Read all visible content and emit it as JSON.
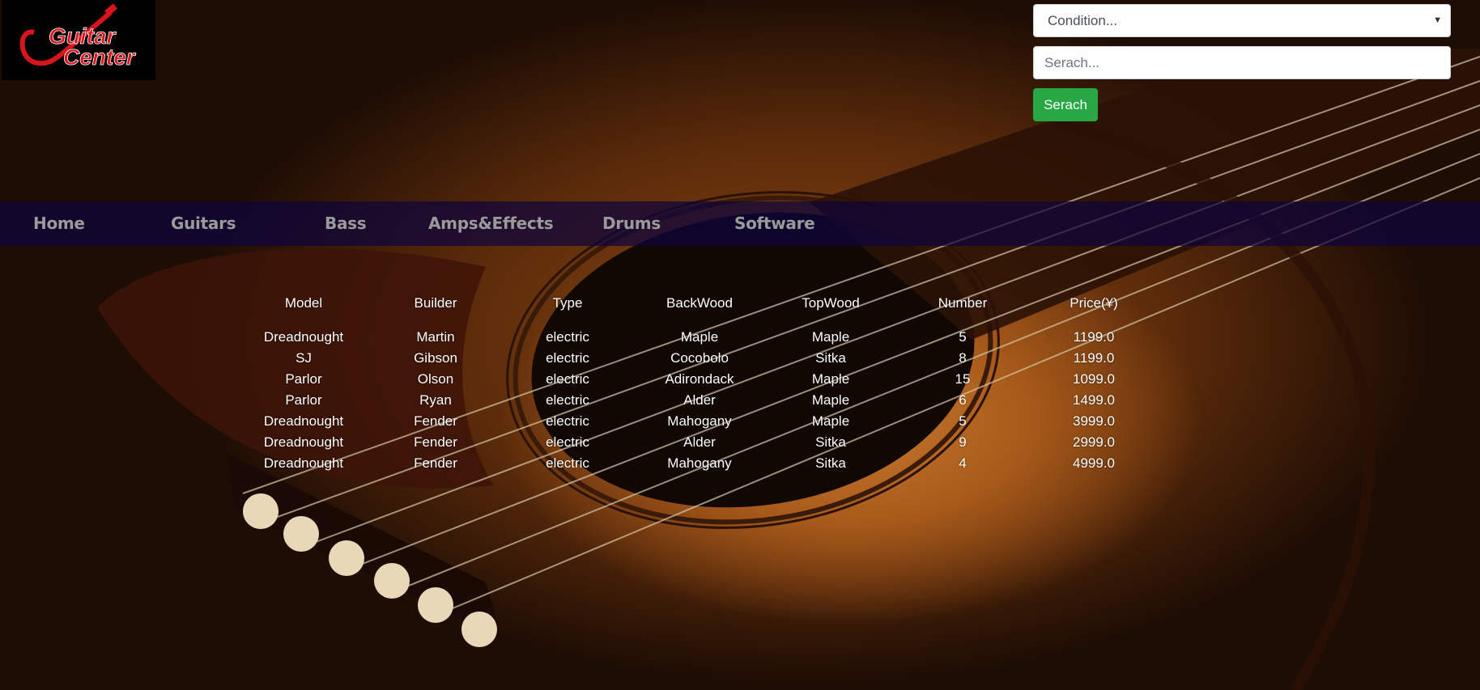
{
  "logo": {
    "text_line1": "Guitar",
    "text_line2": "Center"
  },
  "search": {
    "condition_placeholder": "Condition...",
    "input_placeholder": "Serach...",
    "button_label": "Serach"
  },
  "nav": {
    "items": [
      {
        "label": "Home"
      },
      {
        "label": "Guitars"
      },
      {
        "label": "Bass"
      },
      {
        "label": "Amps&Effects"
      },
      {
        "label": "Drums"
      },
      {
        "label": "Software"
      }
    ]
  },
  "table": {
    "headers": [
      "Model",
      "Builder",
      "Type",
      "BackWood",
      "TopWood",
      "Number",
      "Price(¥)"
    ],
    "rows": [
      [
        "Dreadnought",
        "Martin",
        "electric",
        "Maple",
        "Maple",
        "5",
        "1199.0"
      ],
      [
        "SJ",
        "Gibson",
        "electric",
        "Cocobolo",
        "Sitka",
        "8",
        "1199.0"
      ],
      [
        "Parlor",
        "Olson",
        "electric",
        "Adirondack",
        "Maple",
        "15",
        "1099.0"
      ],
      [
        "Parlor",
        "Ryan",
        "electric",
        "Alder",
        "Maple",
        "6",
        "1499.0"
      ],
      [
        "Dreadnought",
        "Fender",
        "electric",
        "Mahogany",
        "Maple",
        "5",
        "3999.0"
      ],
      [
        "Dreadnought",
        "Fender",
        "electric",
        "Alder",
        "Sitka",
        "9",
        "2999.0"
      ],
      [
        "Dreadnought",
        "Fender",
        "electric",
        "Mahogany",
        "Sitka",
        "4",
        "4999.0"
      ]
    ]
  },
  "colors": {
    "nav_bg": "#0e043c",
    "nav_text": "#9a9a9a",
    "button_bg": "#28a745",
    "logo_red": "#d8141c"
  }
}
